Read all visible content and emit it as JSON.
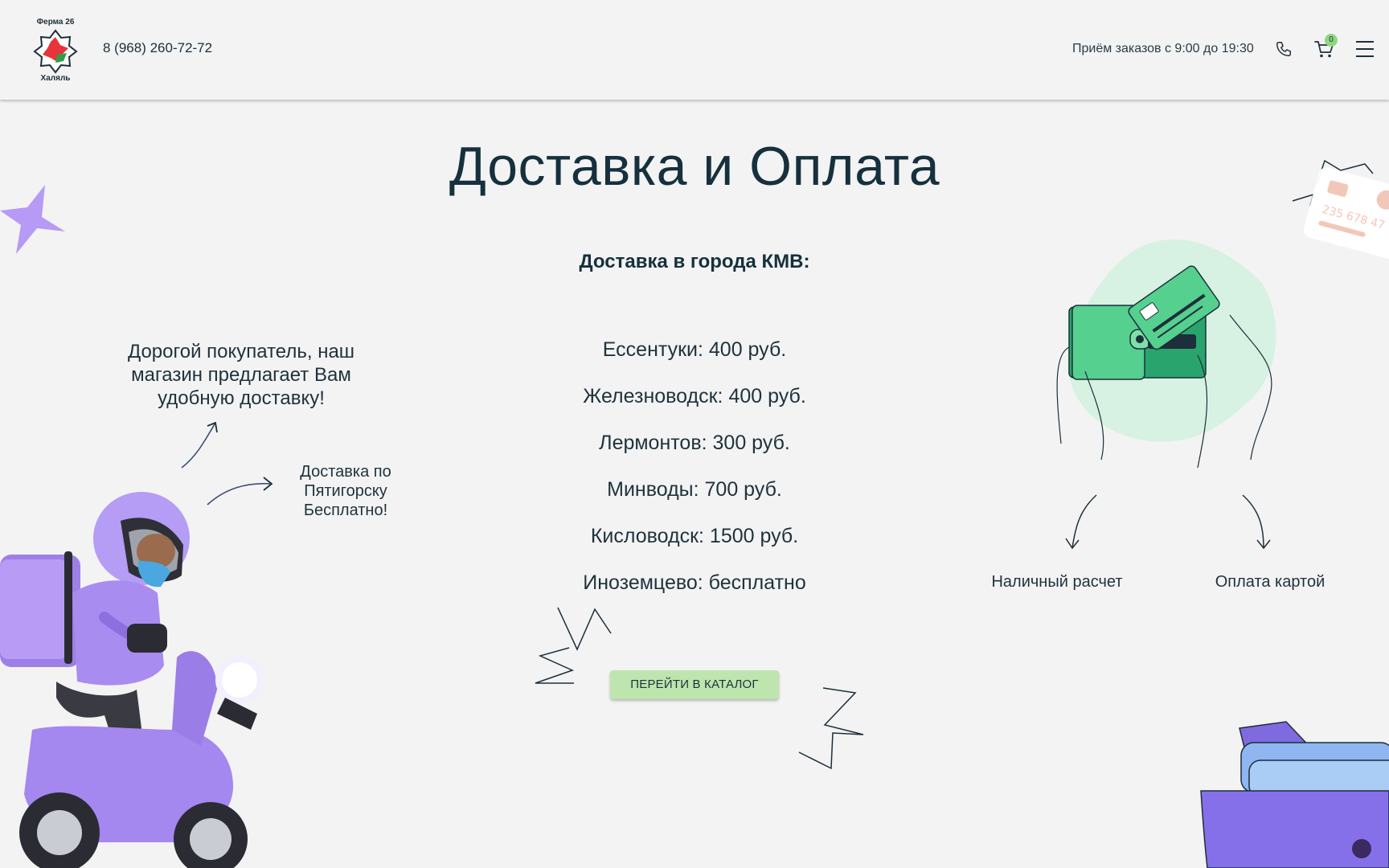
{
  "header": {
    "logo_text_top": "Ферма 26",
    "logo_text_bottom": "Халяль",
    "phone": "8 (968) 260-72-72",
    "hours": "Приём заказов с 9:00 до 19:30",
    "cart_count": "0"
  },
  "page": {
    "title": "Доставка и Оплата",
    "subtitle": "Доставка в города КМВ:"
  },
  "cities": [
    "Ессентуки: 400 руб.",
    "Железноводск:  400 руб.",
    "Лермонтов: 300 руб.",
    "Минводы: 700 руб.",
    "Кисловодск: 1500 руб.",
    "Иноземцево: бесплатно"
  ],
  "notes": {
    "main": "Дорогой покупатель, наш магазин предлагает Вам удобную доставку!",
    "free": "Доставка по Пятигорску Бесплатно!"
  },
  "payment": {
    "cash": "Наличный расчет",
    "card": "Оплата картой"
  },
  "cta": {
    "catalog_label": "ПЕРЕЙТИ В КАТАЛОГ"
  },
  "colors": {
    "background": "#f3f3f3",
    "text": "#16303d",
    "button": "#bde5ad",
    "badge": "#8fd683",
    "purple": "#a98cf0",
    "green": "#4fc98a"
  }
}
